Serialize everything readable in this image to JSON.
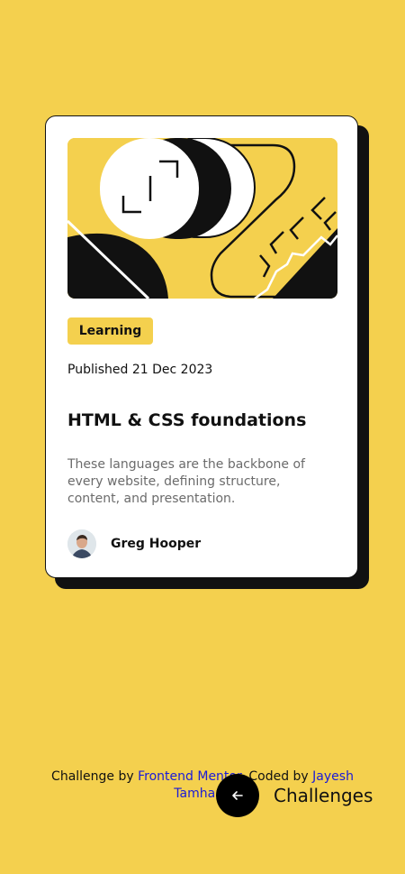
{
  "card": {
    "category": "Learning",
    "published": "Published 21 Dec 2023",
    "title": "HTML & CSS foundations",
    "description": "These languages are the backbone of every website, defining structure, content, and presentation.",
    "author": "Greg Hooper"
  },
  "footer": {
    "challenge_prefix": "Challenge by",
    "challenge_link": "Frontend Mentor",
    "separator": ".",
    "coded_prefix": "Coded by",
    "coded_link": "Jayesh Tamhane",
    "back_icon": "arrow-left-icon",
    "challenges_label": "Challenges"
  },
  "colors": {
    "background": "#f4d04e",
    "card": "#ffffff",
    "ink": "#111111",
    "link": "#1a1ad8",
    "muted_text": "#6b6b6b"
  }
}
